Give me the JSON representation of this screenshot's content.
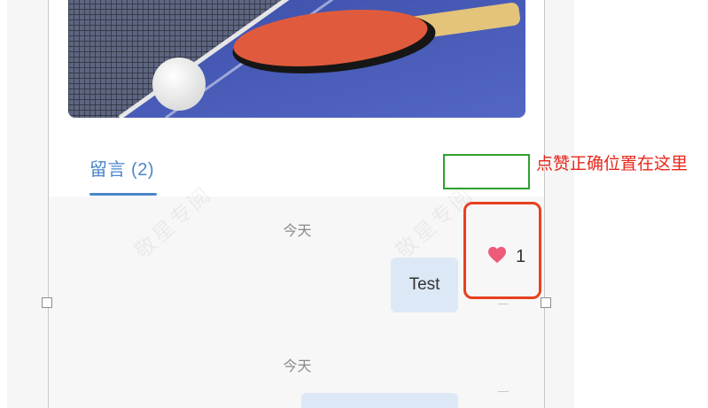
{
  "tabs": [
    {
      "label": "留言 (2)",
      "active": true
    }
  ],
  "messages": [
    {
      "date": "今天",
      "text": "Test",
      "likes": "1"
    },
    {
      "date": "今天",
      "text": ""
    }
  ],
  "watermark": "敬星专阅",
  "annotation": {
    "hint": "点赞正确位置在这里"
  },
  "icons": {
    "like": "heart-icon"
  },
  "colors": {
    "accent": "#4a86c8",
    "bubble": "#dde8f6",
    "heart": "#ee5b78",
    "annotation_red": "#e8261b",
    "annotation_green": "#2ea02e"
  }
}
